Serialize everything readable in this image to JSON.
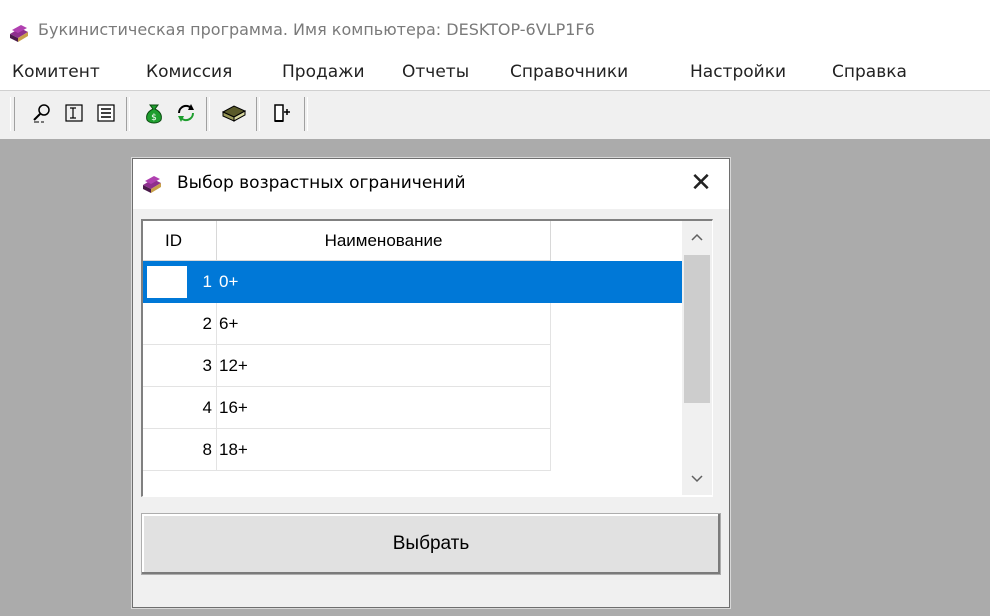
{
  "window": {
    "title": "Букинистическая программа. Имя компьютера: DESKTOP-6VLP1F6",
    "icon": "book-stack-icon"
  },
  "menu": [
    "Комитент",
    "Комиссия",
    "Продажи",
    "Отчеты",
    "Справочники",
    "Настройки",
    "Справка"
  ],
  "toolbar": [
    {
      "icon": "search-person-icon"
    },
    {
      "icon": "text-cursor-icon"
    },
    {
      "icon": "document-list-icon"
    },
    {
      "icon": "money-bag-icon"
    },
    {
      "icon": "refresh-icon"
    },
    {
      "icon": "book-icon"
    },
    {
      "icon": "exit-door-icon"
    }
  ],
  "dialog": {
    "title": "Выбор возрастных ограничений",
    "close_glyph": "✕",
    "columns": {
      "id": "ID",
      "name": "Наименование"
    },
    "rows": [
      {
        "id": "1",
        "name": "0+"
      },
      {
        "id": "2",
        "name": "6+"
      },
      {
        "id": "3",
        "name": "12+"
      },
      {
        "id": "4",
        "name": "16+"
      },
      {
        "id": "8",
        "name": "18+"
      }
    ],
    "selected_index": 0,
    "select_button": "Выбрать"
  },
  "colors": {
    "selection": "#0078d7",
    "desktop": "#ababab",
    "title_text": "#7a7a7a"
  }
}
